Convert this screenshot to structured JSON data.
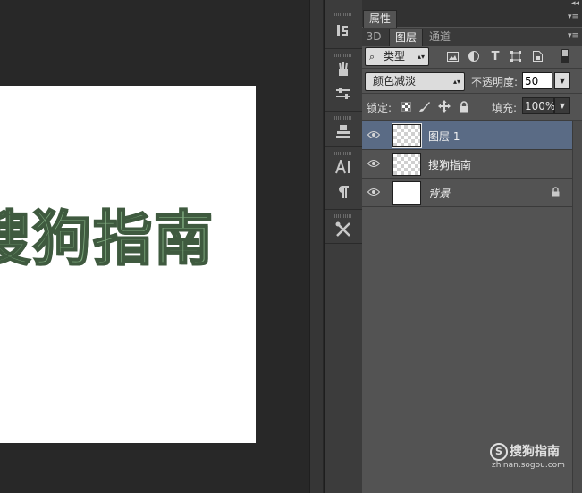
{
  "canvas": {
    "document_text": "搜狗指南"
  },
  "toolbar": {
    "tools": [
      {
        "icon": "history-icon"
      },
      {
        "icon": "brush-presets-icon"
      },
      {
        "icon": "adjustments-icon"
      },
      {
        "icon": "clone-source-icon"
      },
      {
        "icon": "character-icon"
      },
      {
        "icon": "paragraph-icon"
      },
      {
        "icon": "tool-presets-icon"
      }
    ]
  },
  "panel": {
    "properties_tab": "属性",
    "tabs": [
      {
        "label": "3D",
        "active": false
      },
      {
        "label": "图层",
        "active": true
      },
      {
        "label": "通道",
        "active": false
      }
    ],
    "filter": {
      "selected": "类型"
    },
    "blend_mode": "颜色减淡",
    "opacity_label": "不透明度:",
    "opacity_value": "50",
    "lock_label": "锁定:",
    "fill_label": "填充:",
    "fill_value": "100%",
    "layers": [
      {
        "name": "图层 1",
        "selected": true,
        "transparent": true,
        "locked": false,
        "italic": false
      },
      {
        "name": "搜狗指南",
        "selected": false,
        "transparent": true,
        "locked": false,
        "italic": false
      },
      {
        "name": "背景",
        "selected": false,
        "transparent": false,
        "locked": true,
        "italic": true
      }
    ]
  },
  "watermark": {
    "brand": "搜狗指南",
    "url": "zhinan.sogou.com"
  },
  "colors": {
    "selected_layer": "#5a6b85",
    "panel_bg": "#535353",
    "text_green": "#7fab7f"
  }
}
